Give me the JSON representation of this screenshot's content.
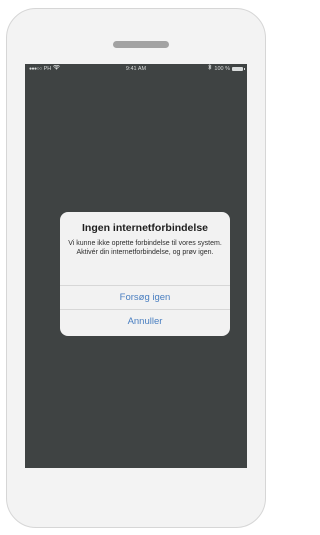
{
  "status_bar": {
    "signal": "●●●○○",
    "carrier": "PH",
    "wifi_icon": "wifi-icon",
    "time": "9:41 AM",
    "bluetooth_icon": "bluetooth-icon",
    "battery_pct": "100 %",
    "battery_level": 1.0
  },
  "alert": {
    "title": "Ingen internetforbindelse",
    "message": "Vi kunne ikke oprette forbindelse til vores system. Aktivér din internetforbindelse, og prøv igen.",
    "buttons": {
      "retry": "Forsøg igen",
      "cancel": "Annuller"
    }
  },
  "colors": {
    "screen_background": "#3f4343",
    "alert_background": "#f2f2f2",
    "button_text": "#4a7fc1",
    "phone_body": "#f3f3f3"
  }
}
